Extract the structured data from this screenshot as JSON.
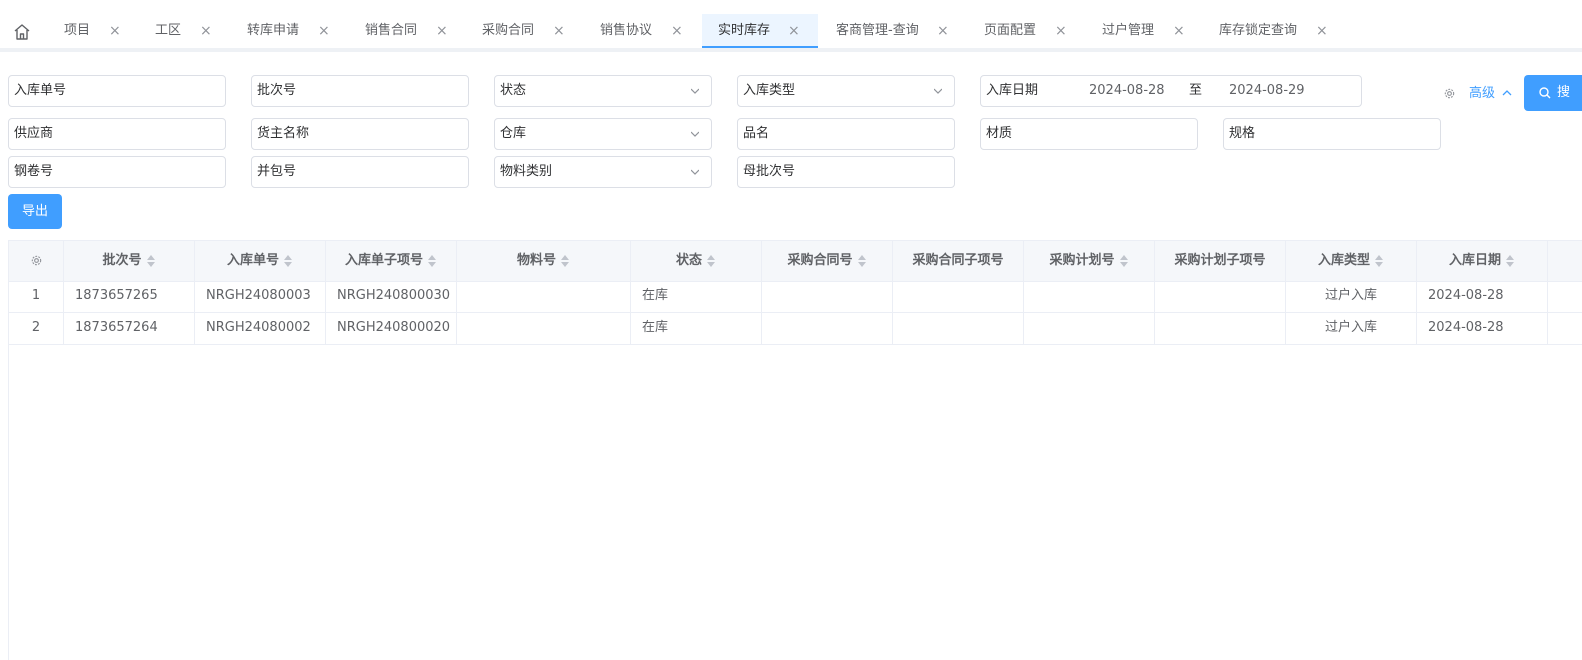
{
  "tabs": [
    {
      "label": "项目",
      "active": false
    },
    {
      "label": "工区",
      "active": false
    },
    {
      "label": "转库申请",
      "active": false
    },
    {
      "label": "销售合同",
      "active": false
    },
    {
      "label": "采购合同",
      "active": false
    },
    {
      "label": "销售协议",
      "active": false
    },
    {
      "label": "实时库存",
      "active": true
    },
    {
      "label": "客商管理-查询",
      "active": false
    },
    {
      "label": "页面配置",
      "active": false
    },
    {
      "label": "过户管理",
      "active": false
    },
    {
      "label": "库存锁定查询",
      "active": false
    }
  ],
  "filters": {
    "inbound_no": "入库单号",
    "batch_no": "批次号",
    "status": "状态",
    "inbound_type": "入库类型",
    "inbound_date": "入库日期",
    "date_from": "2024-08-28",
    "date_sep": "至",
    "date_to": "2024-08-29",
    "supplier": "供应商",
    "owner_name": "货主名称",
    "warehouse": "仓库",
    "product_name": "品名",
    "material": "材质",
    "spec": "规格",
    "coil_no": "钢卷号",
    "bundle_no": "并包号",
    "material_category": "物料类别",
    "parent_batch_no": "母批次号"
  },
  "toolbar": {
    "advanced_label": "高级",
    "search_label": "搜",
    "export_label": "导出"
  },
  "table": {
    "columns": [
      "批次号",
      "入库单号",
      "入库单子项号",
      "物料号",
      "状态",
      "采购合同号",
      "采购合同子项号",
      "采购计划号",
      "采购计划子项号",
      "入库类型",
      "入库日期"
    ],
    "rows": [
      {
        "index": "1",
        "batch_no": "1873657265",
        "inbound_no": "NRGH24080003",
        "inbound_item": "NRGH240800030",
        "material_no": "",
        "status": "在库",
        "pc_no": "",
        "pc_item": "",
        "pp_no": "",
        "pp_item": "",
        "inbound_type": "过户入库",
        "inbound_date": "2024-08-28"
      },
      {
        "index": "2",
        "batch_no": "1873657264",
        "inbound_no": "NRGH24080002",
        "inbound_item": "NRGH240800020",
        "material_no": "",
        "status": "在库",
        "pc_no": "",
        "pc_item": "",
        "pp_no": "",
        "pp_item": "",
        "inbound_type": "过户入库",
        "inbound_date": "2024-08-28"
      }
    ]
  },
  "colors": {
    "accent": "#409eff",
    "border": "#dcdfe6",
    "header_bg": "#f5f7fa"
  }
}
